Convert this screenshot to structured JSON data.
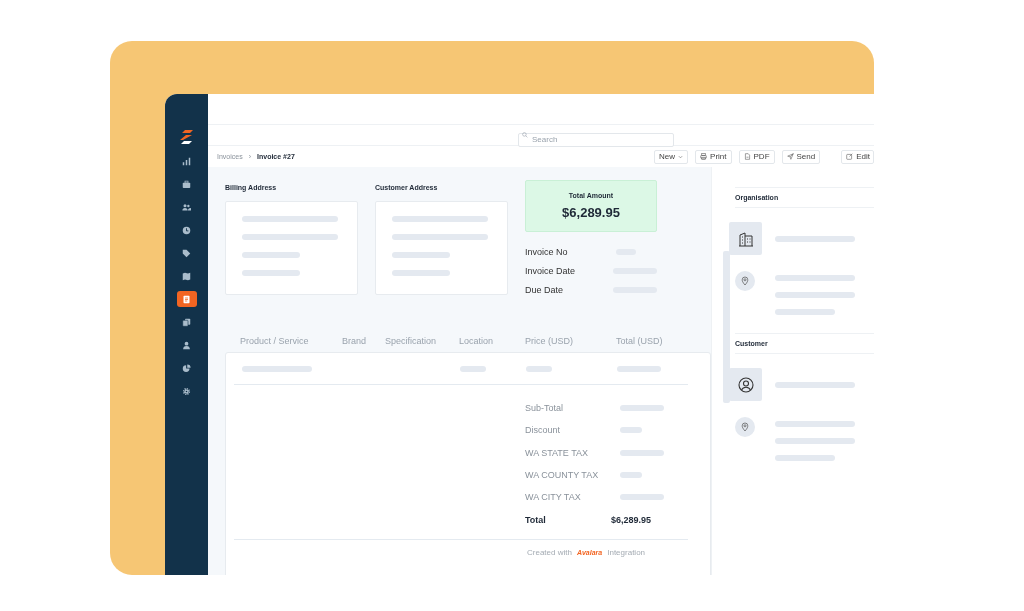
{
  "sidebar": {
    "items": [
      {
        "kind": "chart",
        "selected": false
      },
      {
        "kind": "briefcase",
        "selected": false
      },
      {
        "kind": "users",
        "selected": false
      },
      {
        "kind": "clock",
        "selected": false
      },
      {
        "kind": "tag",
        "selected": false
      },
      {
        "kind": "map",
        "selected": false
      },
      {
        "kind": "document",
        "selected": true
      },
      {
        "kind": "documents",
        "selected": false
      },
      {
        "kind": "user",
        "selected": false
      },
      {
        "kind": "pie-chart",
        "selected": false
      },
      {
        "kind": "gear",
        "selected": false
      }
    ]
  },
  "search": {
    "placeholder": "Search"
  },
  "breadcrumb": {
    "separator": "›",
    "items": [
      {
        "label": "Invoices",
        "current": false
      },
      {
        "label": "Invoice #27",
        "current": true
      }
    ]
  },
  "toolbar": [
    {
      "kind": "dropdown",
      "label": "New"
    },
    {
      "kind": "print",
      "label": "Print"
    },
    {
      "kind": "pdf",
      "label": "PDF"
    },
    {
      "kind": "send",
      "label": "Send"
    },
    {
      "kind": "edit",
      "label": "Edit"
    }
  ],
  "addresses": [
    {
      "label": "Billing Address"
    },
    {
      "label": "Customer Address"
    }
  ],
  "total_amount": {
    "label": "Total Amount",
    "value": "$6,289.95"
  },
  "invoice_fields": [
    {
      "label": "Invoice No"
    },
    {
      "label": "Invoice Date"
    },
    {
      "label": "Due Date"
    }
  ],
  "table": {
    "columns": [
      "Product / Service",
      "Brand",
      "Specification",
      "Location",
      "Price (USD)",
      "Total (USD)"
    ]
  },
  "summary": [
    {
      "kind": "pending",
      "label": "Sub-Total"
    },
    {
      "kind": "pending",
      "label": "Discount"
    },
    {
      "kind": "pending",
      "label": "WA STATE TAX"
    },
    {
      "kind": "pending",
      "label": "WA COUNTY TAX"
    },
    {
      "kind": "pending",
      "label": "WA CITY TAX"
    },
    {
      "kind": "total",
      "label": "Total",
      "value": "$6,289.95"
    }
  ],
  "footer": {
    "prefix": "Created with",
    "brand": "Avalara",
    "suffix": "Integration"
  },
  "side_panel": {
    "sections": [
      {
        "kind": "organisation",
        "title": "Organisation"
      },
      {
        "kind": "customer",
        "title": "Customer"
      }
    ]
  }
}
